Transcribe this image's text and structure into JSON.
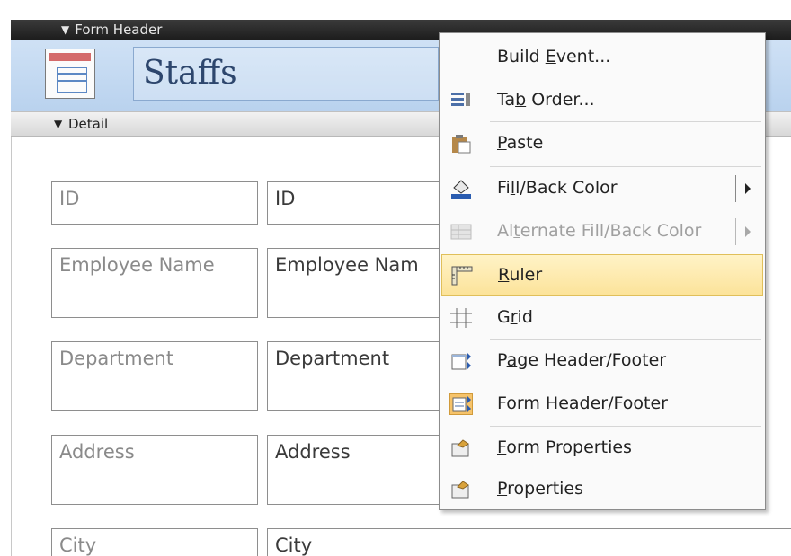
{
  "form": {
    "header_section_label": "Form Header",
    "title": "Staffs",
    "detail_section_label": "Detail"
  },
  "fields": [
    {
      "label": "ID",
      "control": "ID"
    },
    {
      "label": "Employee Name",
      "control": "Employee Nam"
    },
    {
      "label": "Department",
      "control": "Department"
    },
    {
      "label": "Address",
      "control": "Address"
    },
    {
      "label": "City",
      "control": "City"
    }
  ],
  "context_menu": {
    "items": [
      {
        "pre": "Build ",
        "key": "E",
        "post": "vent...",
        "icon": "none",
        "state": "normal"
      },
      {
        "pre": "Ta",
        "key": "b",
        "post": " Order...",
        "icon": "tab-order-icon",
        "state": "normal"
      },
      {
        "pre": "",
        "key": "P",
        "post": "aste",
        "icon": "paste-icon",
        "state": "normal"
      },
      {
        "pre": "Fi",
        "key": "l",
        "post": "l/Back Color",
        "icon": "fill-color-icon",
        "state": "normal",
        "submenu": true
      },
      {
        "pre": "Al",
        "key": "t",
        "post": "ernate Fill/Back Color",
        "icon": "alternate-fill-icon",
        "state": "disabled",
        "submenu": true
      },
      {
        "pre": "",
        "key": "R",
        "post": "uler",
        "icon": "ruler-icon",
        "state": "highlighted"
      },
      {
        "pre": "G",
        "key": "r",
        "post": "id",
        "icon": "grid-icon",
        "state": "normal"
      },
      {
        "pre": "P",
        "key": "a",
        "post": "ge Header/Footer",
        "icon": "page-header-footer-icon",
        "state": "normal"
      },
      {
        "pre": "Form ",
        "key": "H",
        "post": "eader/Footer",
        "icon": "form-header-footer-icon",
        "state": "active"
      },
      {
        "pre": "",
        "key": "F",
        "post": "orm Properties",
        "icon": "form-properties-icon",
        "state": "normal"
      },
      {
        "pre": "",
        "key": "P",
        "post": "roperties",
        "icon": "properties-icon",
        "state": "normal"
      }
    ]
  },
  "colors": {
    "header_band": "#c6dbf2",
    "title_text": "#2d466d",
    "highlight": "#fce39a"
  }
}
